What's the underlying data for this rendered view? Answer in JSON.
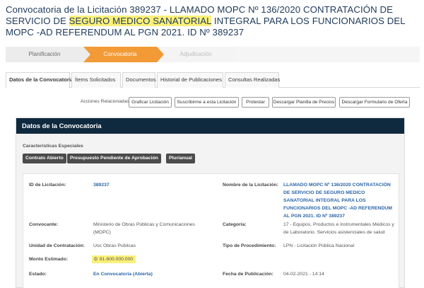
{
  "title": {
    "part1": "Convocatoria de la Licitación 389237 - LLAMADO MOPC Nº 136/2020 CONTRATACIÓN DE SERVICIO DE ",
    "highlight": "SEGURO MEDICO SANATORIAL",
    "part2": " INTEGRAL PARA LOS FUNCIONARIOS DEL MOPC -AD REFERENDUM AL PGN 2021. ID Nº 389237",
    "highlight_color": "#fbf07a"
  },
  "steps": [
    "Planificación",
    "Convocatoria",
    "Adjudicación"
  ],
  "active_step_color": "#f29a36",
  "tabs": [
    "Datos de la Convocatoria",
    "Ítems Solicitados",
    "Documentos",
    "Historial de Publicaciones",
    "Consultas Realizadas"
  ],
  "actions": {
    "label": "Acciones Relacionadas:",
    "buttons": [
      "Graficar Licitación",
      "Suscribirme a esta Licitación",
      "Protestar",
      "Descargar Planilla de Precios",
      "Descargar Formulario de Oferta"
    ]
  },
  "panel": {
    "header": "Datos de la Convocatoria",
    "header_color": "#0f2a3f",
    "features_label": "Características Especiales",
    "badges": [
      "Contrato Abierto",
      "Presupuesto Pendiente de Aprobación",
      "Plurianual"
    ]
  },
  "fields": {
    "id_label": "ID de Licitación:",
    "id_value": "389237",
    "name_label": "Nombre de la Licitación:",
    "name_value": "LLAMADO MOPC Nº 136/2020 CONTRATACIÓN DE SERVICIO DE SEGURO MEDICO SANATORIAL INTEGRAL PARA LOS FUNCIONARIOS DEL MOPC -AD REFERENDUM AL PGN 2021. ID Nº 389237",
    "convocante_label": "Convocante:",
    "convocante_value": "Ministerio de Obras Públicas y Comunicaciones (MOPC)",
    "categoria_label": "Categoría:",
    "categoria_value": "17 - Equipos, Productos e instrumentales Médicos y de Laboratorio. Servicios asistenciales de salud",
    "unidad_label": "Unidad de Contratación:",
    "unidad_value": "Uoc Obras Publicas",
    "procedimiento_label": "Tipo de Procedimiento:",
    "procedimiento_value": "LPN - Licitación Pública Nacional",
    "monto_label": "Monto Estimado:",
    "monto_icon": "₲",
    "monto_value": "81.600.000.000",
    "estado_label": "Estado:",
    "estado_value": "En Convocatoria (Abierta)",
    "fecha_label": "Fecha de Publicación:",
    "fecha_value": "04-02-2021 - 14:14"
  }
}
